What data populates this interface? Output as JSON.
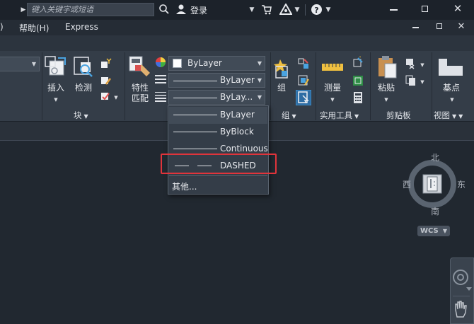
{
  "titlebar": {
    "search_placeholder": "键入关键字或短语",
    "login_label": "登录"
  },
  "menubar": {
    "items": [
      ")",
      "帮助(H)",
      "Express"
    ]
  },
  "ribbon": {
    "block_panel": {
      "insert_label": "插入",
      "detect_label": "检测",
      "title": "块"
    },
    "properties_panel": {
      "match_label_1": "特性",
      "match_label_2": "匹配",
      "color_value": "ByLayer",
      "linetype_value": "ByLayer",
      "lineweight_value": "ByLay..."
    },
    "groups_panel": {
      "group_label": "组",
      "title": "组"
    },
    "utilities_panel": {
      "measure_label": "测量",
      "title": "实用工具"
    },
    "clipboard_panel": {
      "paste_label": "粘贴",
      "title": "剪贴板"
    },
    "view_panel": {
      "base_label": "基点",
      "title": "视图"
    }
  },
  "linetype_dropdown": {
    "options": [
      {
        "label": "ByLayer",
        "style": "solid"
      },
      {
        "label": "ByBlock",
        "style": "solid"
      },
      {
        "label": "Continuous",
        "style": "solid"
      },
      {
        "label": "DASHED",
        "style": "dashed"
      }
    ],
    "other_label": "其他..."
  },
  "viewcube": {
    "north": "北",
    "south": "南",
    "east": "东",
    "west": "西",
    "wcs_label": "WCS"
  },
  "colors": {
    "highlight": "#e0343b",
    "ribbon_bg": "#343d48",
    "canvas_bg": "#212830"
  }
}
